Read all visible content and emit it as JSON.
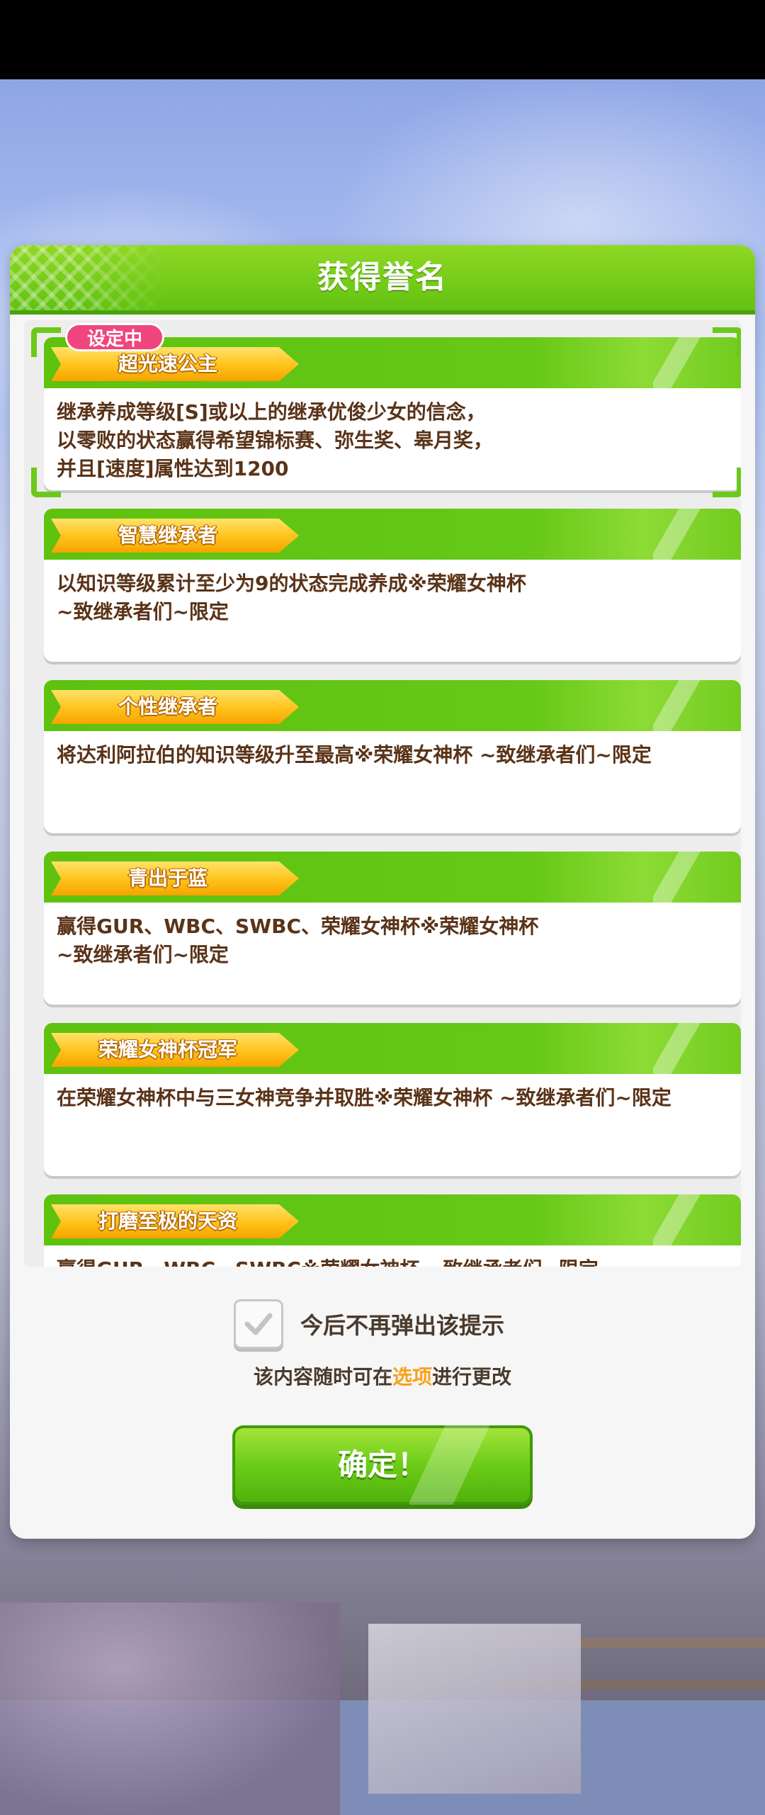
{
  "dialog": {
    "title": "获得誉名"
  },
  "titles": [
    {
      "name": "超光速公主",
      "description": "继承养成等级[S]或以上的继承优俊少女的信念，\n以零败的状态赢得希望锦标赛、弥生奖、皋月奖，\n并且[速度]属性达到1200",
      "badge": "设定中",
      "selected": true
    },
    {
      "name": "智慧继承者",
      "description": "以知识等级累计至少为9的状态完成养成※荣耀女神杯\n~致继承者们~限定",
      "selected": false
    },
    {
      "name": "个性继承者",
      "description": "将达利阿拉伯的知识等级升至最高※荣耀女神杯 ~致继承者们~限定",
      "selected": false
    },
    {
      "name": "青出于蓝",
      "description": "赢得GUR、WBC、SWBC、荣耀女神杯※荣耀女神杯\n~致继承者们~限定",
      "selected": false
    },
    {
      "name": "荣耀女神杯冠军",
      "description": "在荣耀女神杯中与三女神竞争并取胜※荣耀女神杯 ~致继承者们~限定",
      "selected": false
    },
    {
      "name": "打磨至极的天资",
      "description": "赢得GUR、WBC、SWBC※荣耀女神杯 ~致继承者们~限定",
      "selected": false
    }
  ],
  "footer": {
    "dont_show_again": "今后不再弹出该提示",
    "dont_show_checked": true,
    "hint_prefix": "该内容随时可在",
    "hint_link": "选项",
    "hint_suffix": "进行更改",
    "confirm_label": "确定！"
  },
  "colors": {
    "header_green": "#62c212",
    "ribbon_orange": "#ffc21a",
    "badge_pink": "#f0457e",
    "text_brown": "#5a3318",
    "link_orange": "#f7a21b"
  }
}
